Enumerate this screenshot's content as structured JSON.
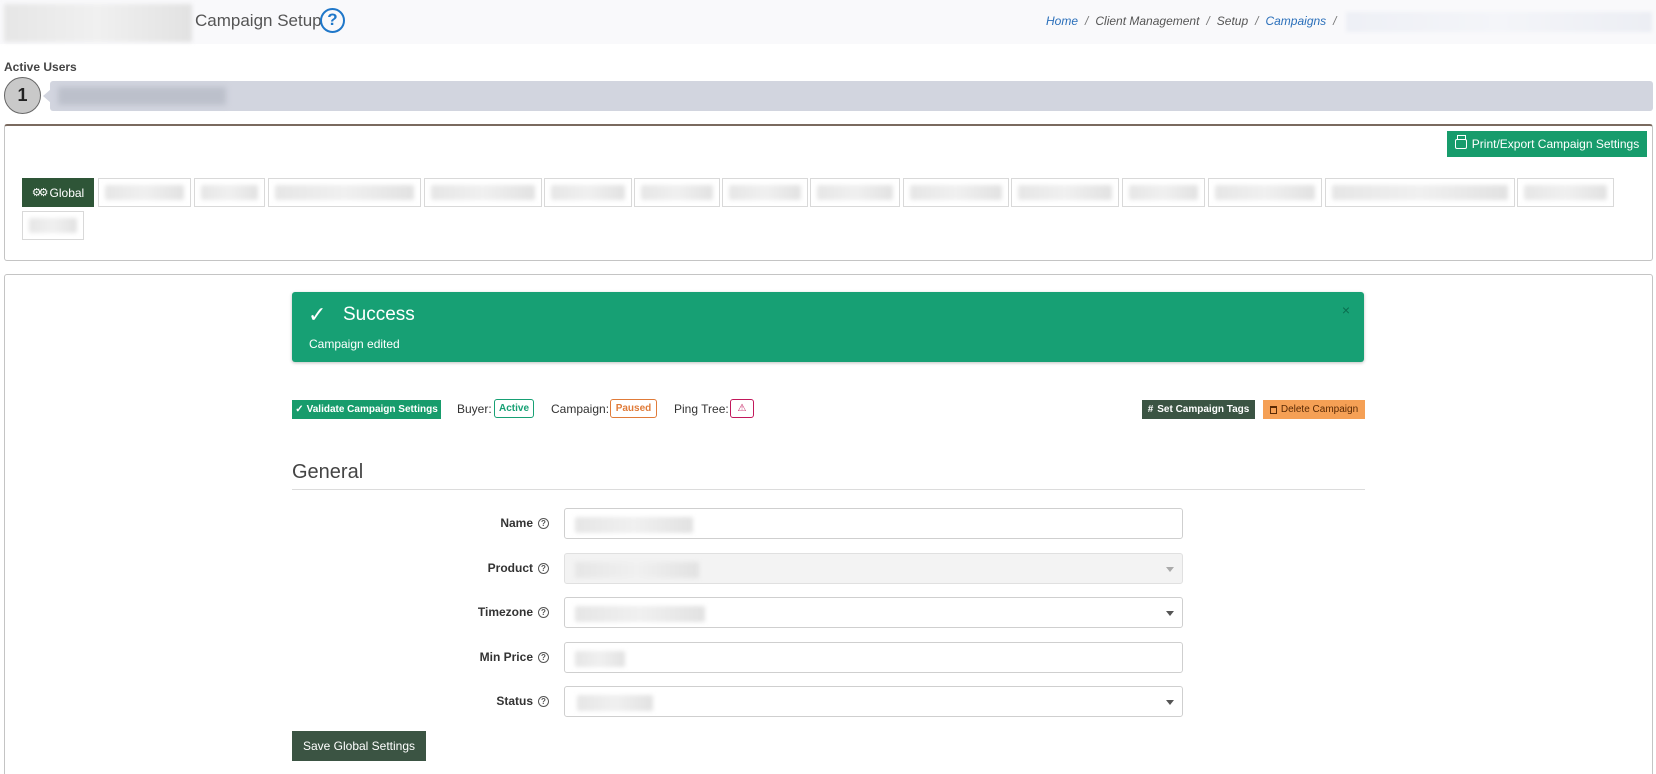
{
  "header": {
    "title": "Campaign Setup",
    "help_icon": "question-circle-icon",
    "breadcrumb": {
      "home": "Home",
      "client_management": "Client Management",
      "setup": "Setup",
      "campaigns": "Campaigns",
      "separator": "/"
    }
  },
  "active_users": {
    "label": "Active Users",
    "count": "1"
  },
  "toolbar": {
    "export_label": "Print/Export Campaign Settings",
    "export_icon": "printer-icon"
  },
  "tabs": {
    "global_label": "Global",
    "global_icon": "gears-icon"
  },
  "alert": {
    "title": "Success",
    "message": "Campaign edited",
    "close": "×",
    "check": "✓",
    "color": "#17a074"
  },
  "status_bar": {
    "validate_label": "Validate Campaign Settings",
    "buyer_label": "Buyer:",
    "buyer_status": "Active",
    "campaign_label": "Campaign:",
    "campaign_status": "Paused",
    "ping_tree_label": "Ping Tree:",
    "ping_tree_status": "⚠",
    "tags_label": "Set Campaign Tags",
    "tags_icon": "#",
    "delete_label": "Delete Campaign"
  },
  "form": {
    "section_title": "General",
    "fields": [
      {
        "label": "Name"
      },
      {
        "label": "Product"
      },
      {
        "label": "Timezone"
      },
      {
        "label": "Min Price"
      },
      {
        "label": "Status"
      }
    ],
    "help_glyph": "?",
    "save_label": "Save Global Settings"
  },
  "colors": {
    "primary_green": "#179c6c",
    "dark_green": "#3b5443",
    "global_tab": "#2e5537",
    "warning_orange": "#f5a055",
    "link_blue": "#2a6fba"
  }
}
